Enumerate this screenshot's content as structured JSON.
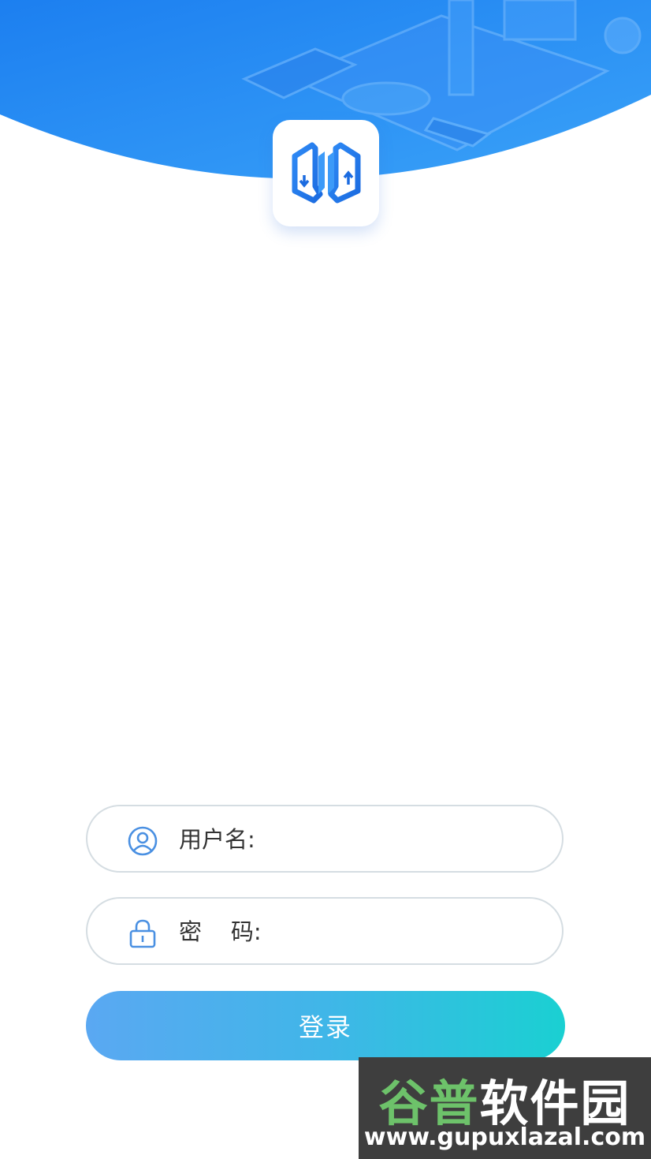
{
  "login": {
    "username_label": "用户名:",
    "password_label": "密    码:",
    "login_button": "登录"
  },
  "icons": {
    "logo": "app-logo-icon",
    "username": "user-circle-icon",
    "password": "lock-icon"
  },
  "colors": {
    "header_blue": "#2b8ff3",
    "button_start": "#5aa8f2",
    "button_end": "#1ad0d2",
    "icon_blue": "#4a90e2"
  },
  "watermark": {
    "title_part1": "谷普",
    "title_part2": "软件园",
    "url": "www.gupuxlazal.com"
  }
}
